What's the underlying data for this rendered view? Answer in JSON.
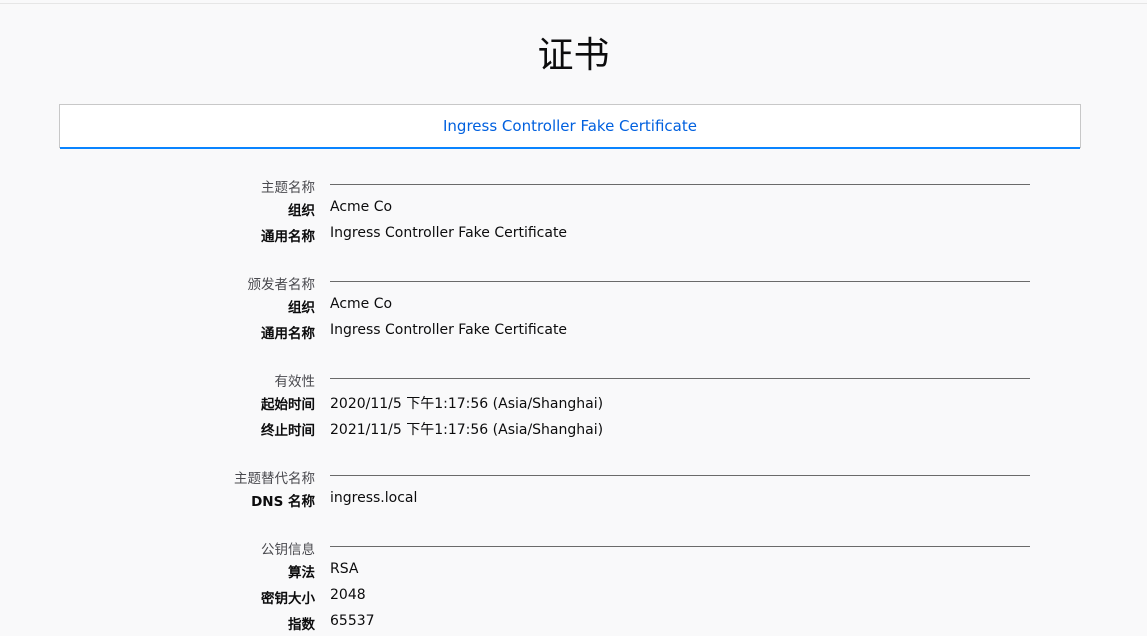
{
  "page": {
    "title": "证书"
  },
  "tabs": [
    {
      "label": "Ingress Controller Fake Certificate",
      "active": true
    }
  ],
  "colors": {
    "accent": "#0a84ff",
    "tab_text": "#0060df",
    "background": "#f9f9fa"
  },
  "sections": [
    {
      "title": "主题名称",
      "rows": [
        {
          "label": "组织",
          "value": "Acme Co"
        },
        {
          "label": "通用名称",
          "value": "Ingress Controller Fake Certificate"
        }
      ]
    },
    {
      "title": "颁发者名称",
      "rows": [
        {
          "label": "组织",
          "value": "Acme Co"
        },
        {
          "label": "通用名称",
          "value": "Ingress Controller Fake Certificate"
        }
      ]
    },
    {
      "title": "有效性",
      "rows": [
        {
          "label": "起始时间",
          "value": "2020/11/5 下午1:17:56 (Asia/Shanghai)"
        },
        {
          "label": "终止时间",
          "value": "2021/11/5 下午1:17:56 (Asia/Shanghai)"
        }
      ]
    },
    {
      "title": "主题替代名称",
      "rows": [
        {
          "label": "DNS 名称",
          "value": "ingress.local"
        }
      ]
    },
    {
      "title": "公钥信息",
      "rows": [
        {
          "label": "算法",
          "value": "RSA"
        },
        {
          "label": "密钥大小",
          "value": "2048"
        },
        {
          "label": "指数",
          "value": "65537"
        }
      ]
    }
  ]
}
